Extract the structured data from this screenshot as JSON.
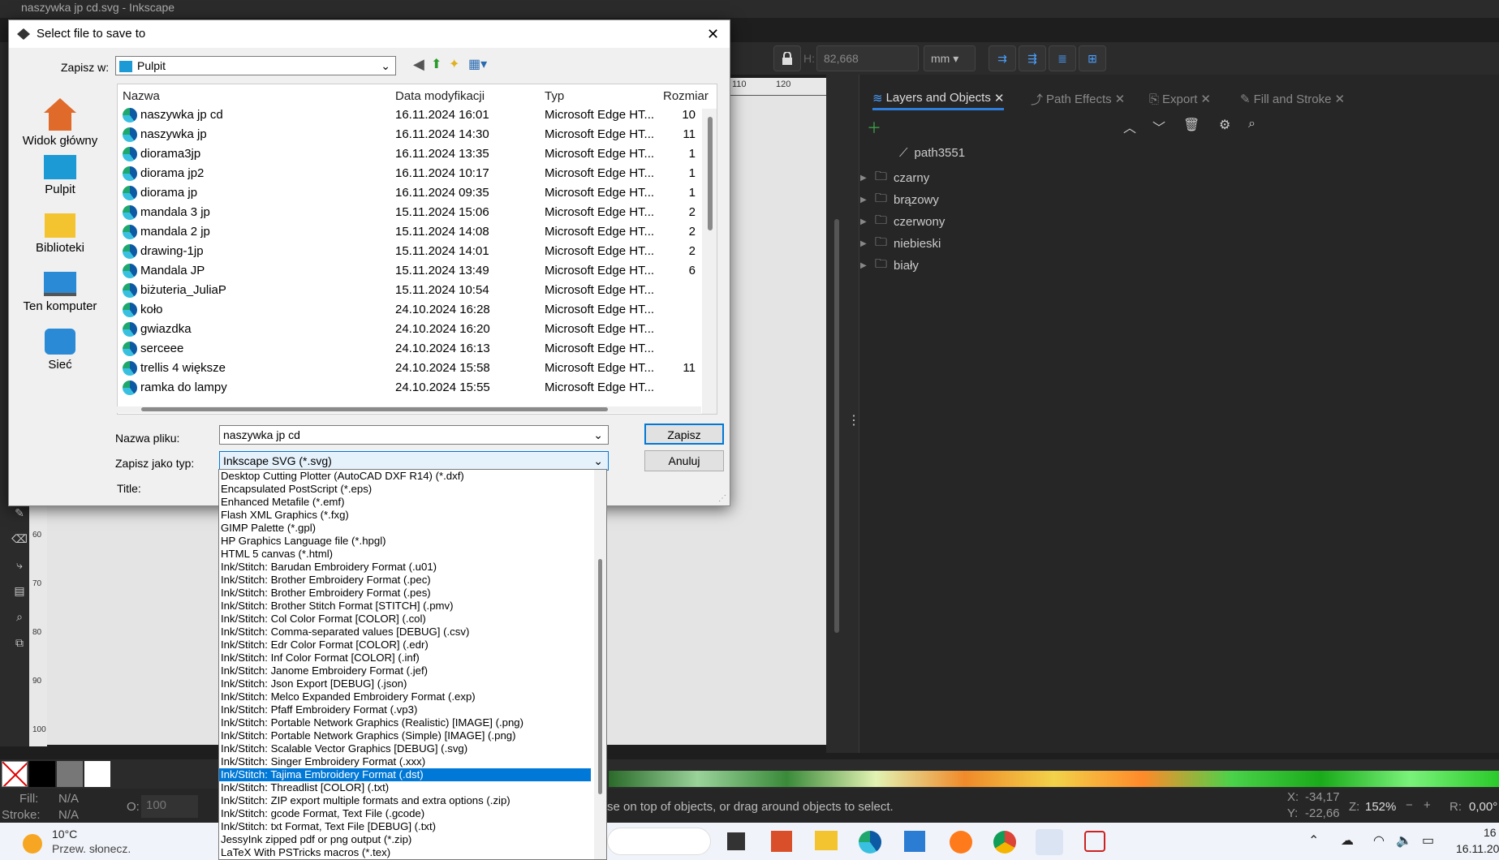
{
  "app": {
    "title": "naszywka jp cd.svg - Inkscape"
  },
  "toolbar": {
    "h_label": "H:",
    "h_value": "82,668",
    "unit": "mm"
  },
  "panel": {
    "tabs": [
      {
        "label": "Layers and Objects"
      },
      {
        "label": "Path Effects"
      },
      {
        "label": "Export"
      },
      {
        "label": "Fill and Stroke"
      }
    ],
    "layers": [
      "path3551",
      "czarny",
      "brązowy",
      "czerwony",
      "niebieski",
      "biały"
    ]
  },
  "dialog": {
    "title": "Select file to save to",
    "save_in_label": "Zapisz w:",
    "save_in_value": "Pulpit",
    "places": [
      "Widok główny",
      "Pulpit",
      "Biblioteki",
      "Ten komputer",
      "Sieć"
    ],
    "columns": [
      "Nazwa",
      "Data modyfikacji",
      "Typ",
      "Rozmiar"
    ],
    "files": [
      {
        "name": "naszywka jp cd",
        "date": "16.11.2024 16:01",
        "type": "Microsoft Edge HT...",
        "size": "10"
      },
      {
        "name": "naszywka jp",
        "date": "16.11.2024 14:30",
        "type": "Microsoft Edge HT...",
        "size": "11"
      },
      {
        "name": "diorama3jp",
        "date": "16.11.2024 13:35",
        "type": "Microsoft Edge HT...",
        "size": "1"
      },
      {
        "name": "diorama jp2",
        "date": "16.11.2024 10:17",
        "type": "Microsoft Edge HT...",
        "size": "1"
      },
      {
        "name": "diorama jp",
        "date": "16.11.2024 09:35",
        "type": "Microsoft Edge HT...",
        "size": "1"
      },
      {
        "name": "mandala 3 jp",
        "date": "15.11.2024 15:06",
        "type": "Microsoft Edge HT...",
        "size": "2"
      },
      {
        "name": "mandala 2 jp",
        "date": "15.11.2024 14:08",
        "type": "Microsoft Edge HT...",
        "size": "2"
      },
      {
        "name": "drawing-1jp",
        "date": "15.11.2024 14:01",
        "type": "Microsoft Edge HT...",
        "size": "2"
      },
      {
        "name": "Mandala JP",
        "date": "15.11.2024 13:49",
        "type": "Microsoft Edge HT...",
        "size": "6"
      },
      {
        "name": "biżuteria_JuliaP",
        "date": "15.11.2024 10:54",
        "type": "Microsoft Edge HT...",
        "size": ""
      },
      {
        "name": "koło",
        "date": "24.10.2024 16:28",
        "type": "Microsoft Edge HT...",
        "size": ""
      },
      {
        "name": "gwiazdka",
        "date": "24.10.2024 16:20",
        "type": "Microsoft Edge HT...",
        "size": ""
      },
      {
        "name": "serceee",
        "date": "24.10.2024 16:13",
        "type": "Microsoft Edge HT...",
        "size": ""
      },
      {
        "name": "trellis 4 większe",
        "date": "24.10.2024 15:58",
        "type": "Microsoft Edge HT...",
        "size": "11"
      },
      {
        "name": "ramka do lampy",
        "date": "24.10.2024 15:55",
        "type": "Microsoft Edge HT...",
        "size": ""
      }
    ],
    "filename_label": "Nazwa pliku:",
    "filename_value": "naszywka jp cd",
    "filetype_label": "Zapisz jako typ:",
    "filetype_value": "Inkscape SVG (*.svg)",
    "title_label": "Title:",
    "save_button": "Zapisz",
    "cancel_button": "Anuluj",
    "filetype_options": [
      "Desktop Cutting Plotter (AutoCAD DXF R14) (*.dxf)",
      "Encapsulated PostScript (*.eps)",
      "Enhanced Metafile (*.emf)",
      "Flash XML Graphics (*.fxg)",
      "GIMP Palette (*.gpl)",
      "HP Graphics Language file (*.hpgl)",
      "HTML 5 canvas (*.html)",
      "Ink/Stitch: Barudan Embroidery Format (.u01)",
      "Ink/Stitch: Brother Embroidery Format (.pec)",
      "Ink/Stitch: Brother Embroidery Format (.pes)",
      "Ink/Stitch: Brother Stitch Format [STITCH] (.pmv)",
      "Ink/Stitch: Col Color Format [COLOR] (.col)",
      "Ink/Stitch: Comma-separated values [DEBUG] (.csv)",
      "Ink/Stitch: Edr Color Format [COLOR] (.edr)",
      "Ink/Stitch: Inf Color Format [COLOR] (.inf)",
      "Ink/Stitch: Janome Embroidery Format (.jef)",
      "Ink/Stitch: Json Export [DEBUG] (.json)",
      "Ink/Stitch: Melco Expanded Embroidery Format (.exp)",
      "Ink/Stitch: Pfaff Embroidery Format (.vp3)",
      "Ink/Stitch: Portable Network Graphics (Realistic) [IMAGE] (.png)",
      "Ink/Stitch: Portable Network Graphics (Simple) [IMAGE] (.png)",
      "Ink/Stitch: Scalable Vector Graphics [DEBUG] (.svg)",
      "Ink/Stitch: Singer Embroidery Format (.xxx)",
      "Ink/Stitch: Tajima Embroidery Format (.dst)",
      "Ink/Stitch: Threadlist [COLOR] (.txt)",
      "Ink/Stitch: ZIP export multiple formats and extra options (.zip)",
      "Ink/Stitch: gcode Format, Text File (.gcode)",
      "Ink/Stitch: txt Format, Text File [DEBUG] (.txt)",
      "JessyInk zipped pdf or png output (*.zip)",
      "LaTeX With PSTricks macros (*.tex)"
    ],
    "selected_option": "Ink/Stitch: Tajima Embroidery Format (.dst)"
  },
  "status": {
    "fill_label": "Fill:",
    "fill_value": "N/A",
    "stroke_label": "Stroke:",
    "stroke_value": "N/A",
    "opacity_label": "O:",
    "opacity_value": "100",
    "message": "se on top of objects, or drag around objects to select.",
    "x_label": "X:",
    "x_value": "-34,17",
    "y_label": "Y:",
    "y_value": "-22,66",
    "zoom_label": "Z:",
    "zoom_value": "152%",
    "rotation_label": "R:",
    "rotation_value": "0,00°"
  },
  "ruler": {
    "marks": [
      "110",
      "120"
    ]
  },
  "vruler": {
    "marks": [
      "60",
      "70",
      "80",
      "90",
      "100"
    ]
  },
  "taskbar": {
    "temperature": "10°C",
    "weather": "Przew. słonecz.",
    "time": "16",
    "date": "16.11.20"
  },
  "colors": {
    "accent": "#2f7ddb",
    "selection": "#0078d7"
  }
}
